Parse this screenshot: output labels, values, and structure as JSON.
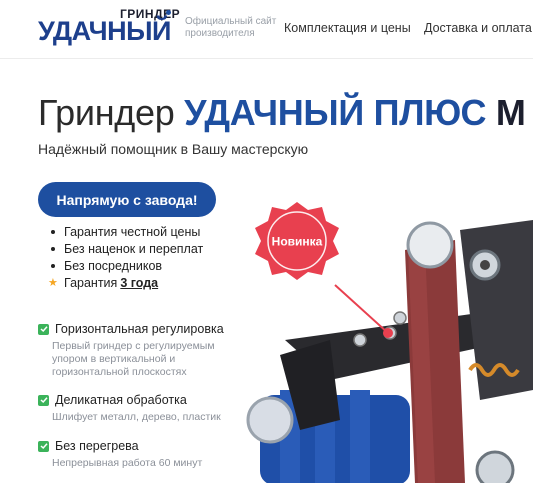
{
  "header": {
    "logo": {
      "small": "ГРИНДЕР",
      "big": "УДАЧНЫЙ"
    },
    "tagline": "Официальный сайт производителя",
    "nav": [
      "Комплектация и цены",
      "Доставка и оплата"
    ]
  },
  "hero": {
    "title_plain": "Гриндер",
    "title_accent": "УДАЧНЫЙ ПЛЮС",
    "title_dark": "М",
    "subtitle": "Надёжный помощник в Вашу мастерскую",
    "cta": "Напрямую с завода!",
    "bullets": [
      "Гарантия честной цены",
      "Без наценок и переплат",
      "Без посредников"
    ],
    "warranty_prefix": "Гарантия",
    "warranty_link": "3 года",
    "badge": "Новинка"
  },
  "features": [
    {
      "title": "Горизонтальная регулировка",
      "desc": "Первый гриндер с регулируемым упором в вертикальной и горизонтальной плоскостях"
    },
    {
      "title": "Деликатная обработка",
      "desc": "Шлифует металл, дерево, пластик"
    },
    {
      "title": "Без перегрева",
      "desc": "Непрерывная работа 60 минут"
    }
  ],
  "colors": {
    "brand_blue": "#1e4fa0",
    "badge_red": "#e8404f",
    "check_green": "#3bb35a"
  },
  "icons": [
    "check-icon",
    "star-icon"
  ]
}
